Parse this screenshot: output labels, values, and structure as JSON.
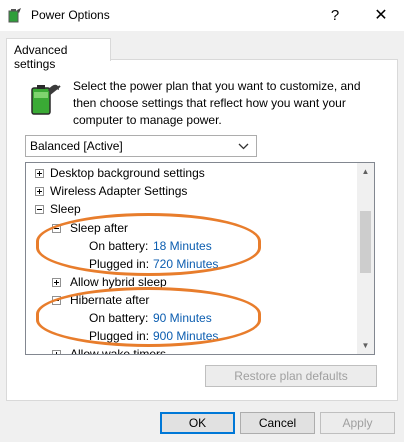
{
  "window": {
    "title": "Power Options",
    "help_symbol": "?",
    "close_symbol": "✕"
  },
  "tab": {
    "label": "Advanced settings"
  },
  "intro_text": "Select the power plan that you want to customize, and then choose settings that reflect how you want your computer to manage power.",
  "plan": {
    "selected": "Balanced [Active]"
  },
  "tree": {
    "desktop_background": "Desktop background settings",
    "wireless_adapter": "Wireless Adapter Settings",
    "sleep": "Sleep",
    "sleep_after": {
      "label": "Sleep after",
      "on_battery_label": "On battery:",
      "on_battery_value": "18 Minutes",
      "plugged_in_label": "Plugged in:",
      "plugged_in_value": "720 Minutes"
    },
    "allow_hybrid_sleep": "Allow hybrid sleep",
    "hibernate_after": {
      "label": "Hibernate after",
      "on_battery_label": "On battery:",
      "on_battery_value": "90 Minutes",
      "plugged_in_label": "Plugged in:",
      "plugged_in_value": "900 Minutes"
    },
    "allow_wake_timers": "Allow wake timers"
  },
  "buttons": {
    "restore": "Restore plan defaults",
    "ok": "OK",
    "cancel": "Cancel",
    "apply": "Apply"
  },
  "colors": {
    "highlight_oval": "#e87d2c",
    "link": "#0b5db0",
    "focus": "#0078d7"
  }
}
